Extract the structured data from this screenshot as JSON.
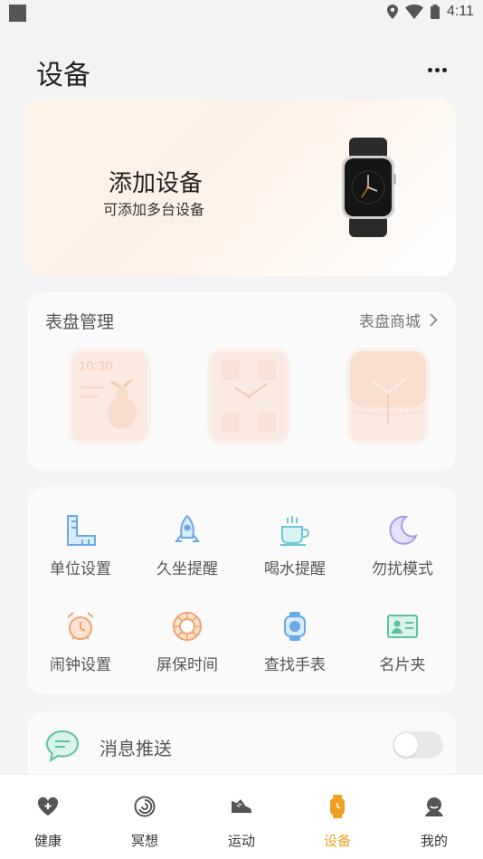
{
  "status_bar": {
    "time": "4:11"
  },
  "header": {
    "title": "设备"
  },
  "hero": {
    "title": "添加设备",
    "subtitle": "可添加多台设备"
  },
  "watch_faces": {
    "title": "表盘管理",
    "store_link": "表盘商城",
    "faces": [
      {
        "time_text": "10:30"
      },
      {},
      {}
    ]
  },
  "features": [
    {
      "label": "单位设置",
      "icon": "ruler-icon",
      "color": "#6aa8e6"
    },
    {
      "label": "久坐提醒",
      "icon": "rocket-icon",
      "color": "#6aa8e6"
    },
    {
      "label": "喝水提醒",
      "icon": "cup-icon",
      "color": "#6cc7d9"
    },
    {
      "label": "勿扰模式",
      "icon": "moon-icon",
      "color": "#a49be8"
    },
    {
      "label": "闹钟设置",
      "icon": "alarm-clock-icon",
      "color": "#f2a36b"
    },
    {
      "label": "屏保时间",
      "icon": "screensaver-icon",
      "color": "#f2a36b"
    },
    {
      "label": "查找手表",
      "icon": "find-watch-icon",
      "color": "#6aa8e6"
    },
    {
      "label": "名片夹",
      "icon": "card-holder-icon",
      "color": "#5bc39b"
    }
  ],
  "notification": {
    "label": "消息推送",
    "enabled": false
  },
  "tabs": [
    {
      "label": "健康",
      "icon": "heart-plus-icon"
    },
    {
      "label": "冥想",
      "icon": "swirl-icon"
    },
    {
      "label": "运动",
      "icon": "shoe-icon"
    },
    {
      "label": "设备",
      "icon": "watch-icon",
      "active": true
    },
    {
      "label": "我的",
      "icon": "profile-icon"
    }
  ],
  "colors": {
    "accent": "#f0a020",
    "background": "#f3f3f3"
  }
}
